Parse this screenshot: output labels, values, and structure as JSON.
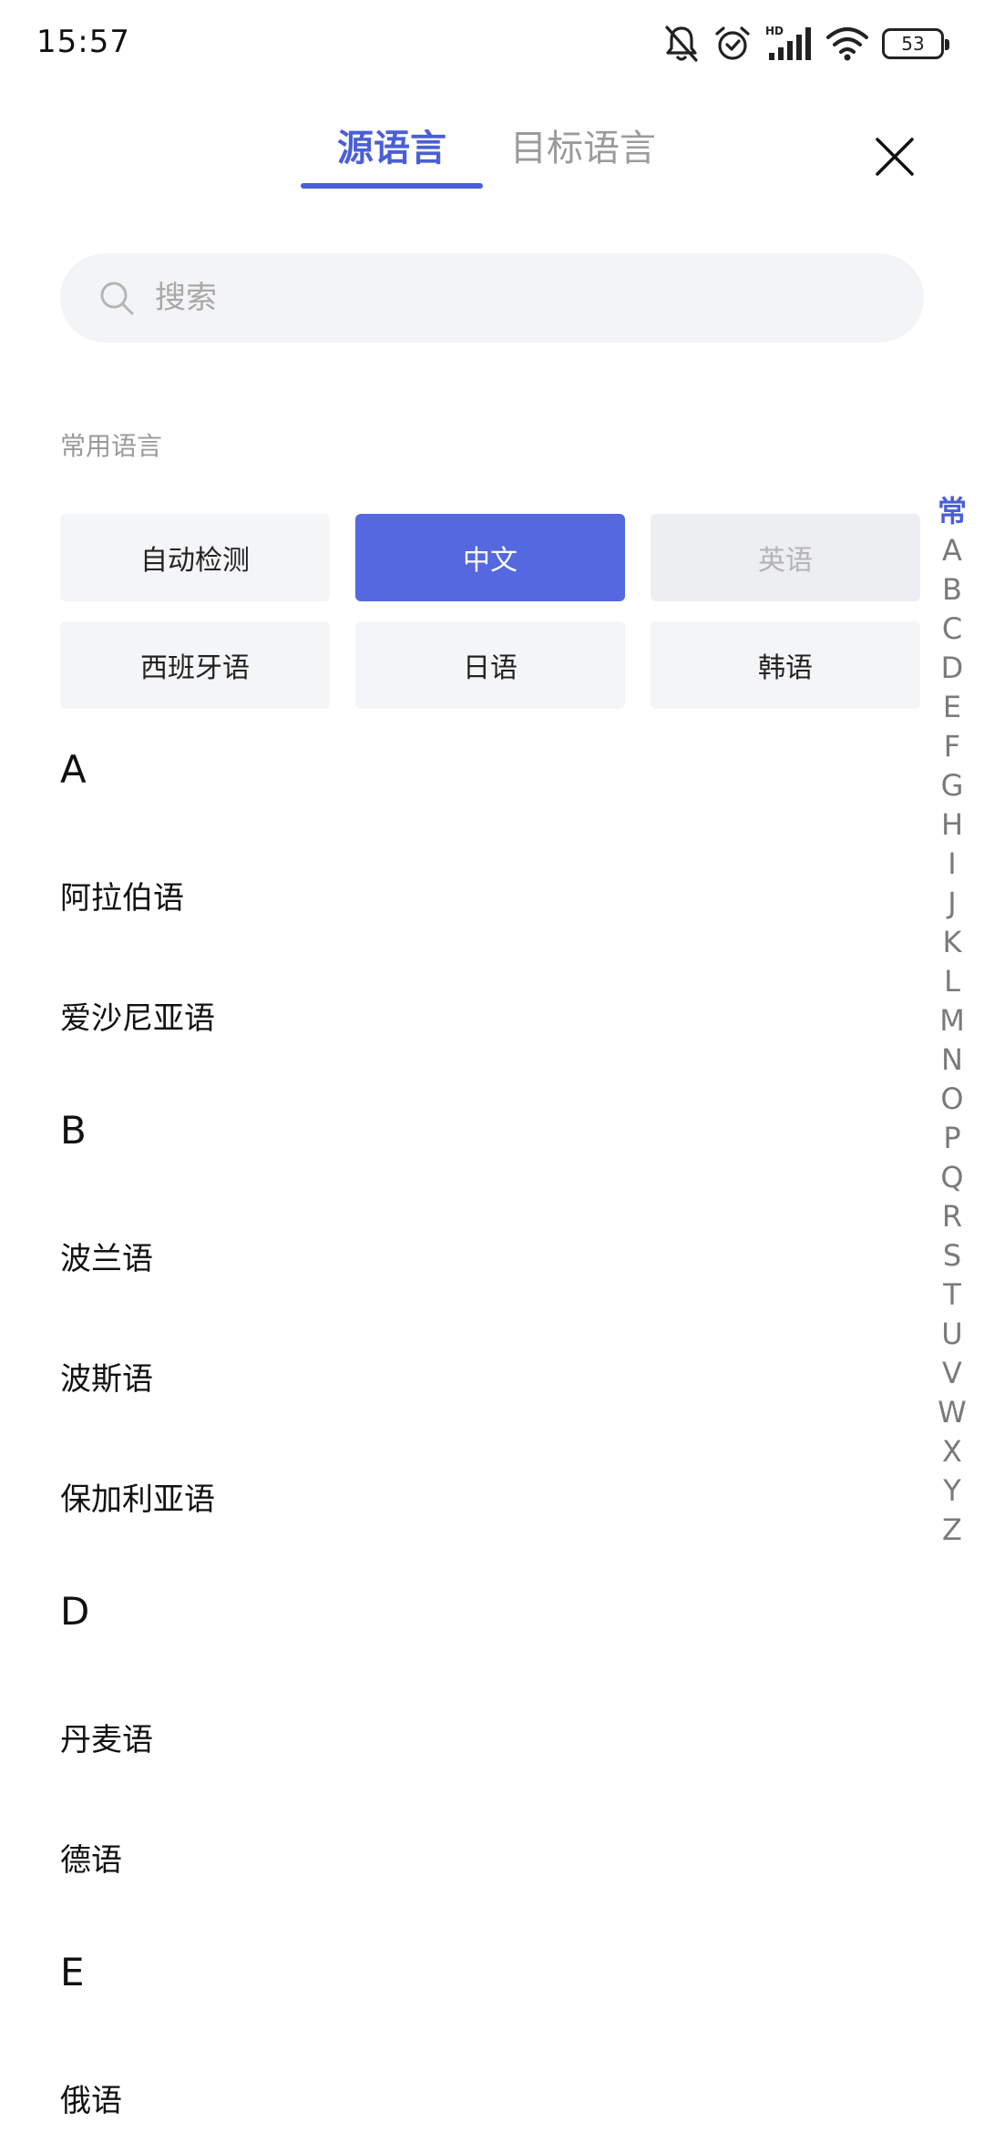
{
  "status_bar": {
    "time": "15:57",
    "signal_badge": "HD",
    "battery": "53"
  },
  "tabs": [
    {
      "label": "源语言",
      "active": true
    },
    {
      "label": "目标语言",
      "active": false
    }
  ],
  "search": {
    "placeholder": "搜索"
  },
  "common_section": {
    "label": "常用语言",
    "items": [
      {
        "label": "自动检测",
        "state": "normal"
      },
      {
        "label": "中文",
        "state": "selected"
      },
      {
        "label": "英语",
        "state": "disabled"
      },
      {
        "label": "西班牙语",
        "state": "normal"
      },
      {
        "label": "日语",
        "state": "normal"
      },
      {
        "label": "韩语",
        "state": "normal"
      }
    ]
  },
  "language_groups": [
    {
      "letter": "A",
      "items": [
        "阿拉伯语",
        "爱沙尼亚语"
      ]
    },
    {
      "letter": "B",
      "items": [
        "波兰语",
        "波斯语",
        "保加利亚语"
      ]
    },
    {
      "letter": "D",
      "items": [
        "丹麦语",
        "德语"
      ]
    },
    {
      "letter": "E",
      "items": [
        "俄语"
      ]
    }
  ],
  "alphabet_index": [
    "常",
    "A",
    "B",
    "C",
    "D",
    "E",
    "F",
    "G",
    "H",
    "I",
    "J",
    "K",
    "L",
    "M",
    "N",
    "O",
    "P",
    "Q",
    "R",
    "S",
    "T",
    "U",
    "V",
    "W",
    "X",
    "Y",
    "Z"
  ],
  "colors": {
    "accent": "#4a5fd6",
    "selected_chip": "#5468e0",
    "chip_bg": "#f4f5f7",
    "muted_text": "#9a9a9a"
  }
}
